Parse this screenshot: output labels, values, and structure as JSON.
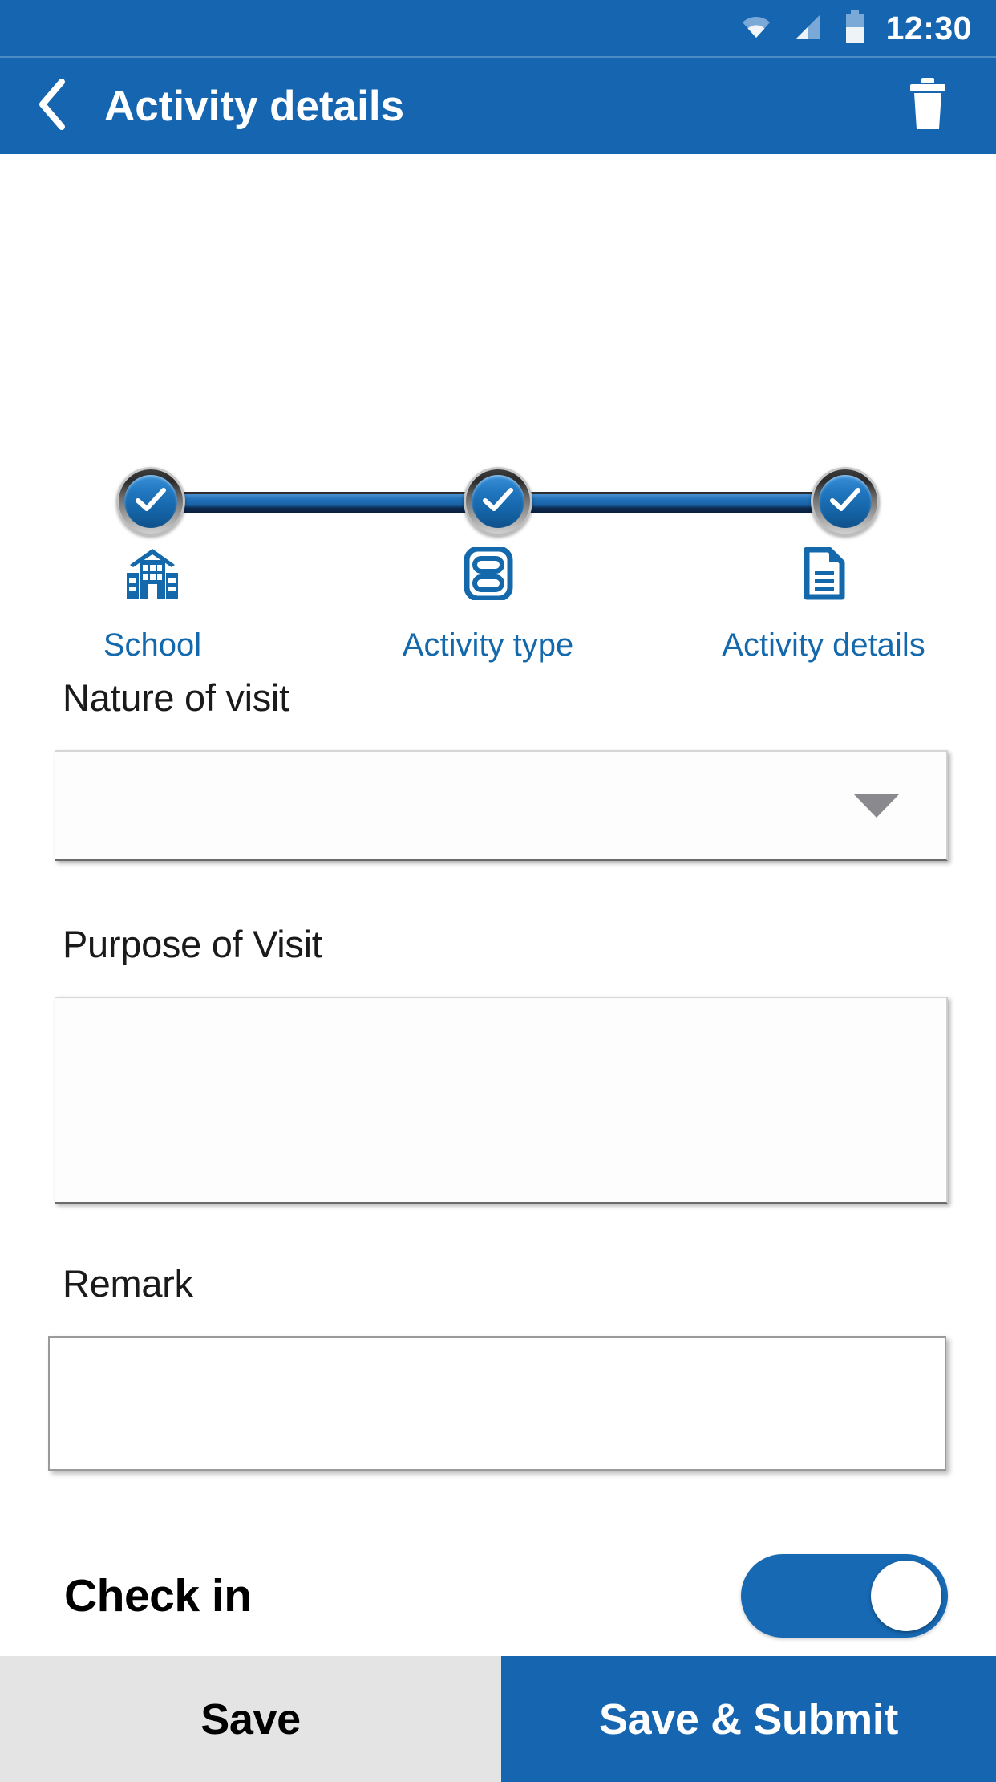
{
  "status_bar": {
    "time": "12:30",
    "icons": [
      "wifi-icon",
      "cellular-signal-icon",
      "battery-icon"
    ]
  },
  "app_bar": {
    "back_icon": "chevron-left-icon",
    "title": "Activity details",
    "delete_icon": "trash-icon"
  },
  "stepper": {
    "steps": [
      {
        "label": "School",
        "icon": "school-building-icon",
        "completed": true
      },
      {
        "label": "Activity type",
        "icon": "activity-type-icon",
        "completed": true
      },
      {
        "label": "Activity details",
        "icon": "document-icon",
        "completed": true
      }
    ],
    "check_glyph": "check-icon",
    "accent_color": "#1469ac"
  },
  "form": {
    "nature_of_visit": {
      "label": "Nature of visit",
      "value": "",
      "placeholder": "",
      "dropdown_icon": "caret-down-icon"
    },
    "purpose_of_visit": {
      "label": "Purpose of Visit",
      "value": "",
      "placeholder": ""
    },
    "remark": {
      "label": "Remark",
      "value": "",
      "placeholder": ""
    },
    "check_in": {
      "label": "Check in",
      "state": "on"
    }
  },
  "bottom_bar": {
    "save_label": "Save",
    "save_submit_label": "Save & Submit"
  },
  "colors": {
    "primary_blue": "#1565b0",
    "link_blue": "#1469ac",
    "button_gray": "#e4e4e4"
  }
}
